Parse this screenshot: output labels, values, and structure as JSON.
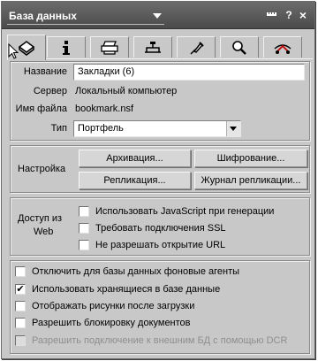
{
  "window": {
    "title": "База данных",
    "min_label": "▫▫▫",
    "help_label": "?",
    "close_label": "×"
  },
  "tabs": [
    {
      "icon": "database-icon",
      "active": true
    },
    {
      "icon": "info-icon"
    },
    {
      "icon": "printer-icon"
    },
    {
      "icon": "design-icon"
    },
    {
      "icon": "launch-icon"
    },
    {
      "icon": "magnifier-icon"
    },
    {
      "icon": "advanced-icon"
    }
  ],
  "basics": {
    "title_label": "Название",
    "title_value": "Закладки (6)",
    "server_label": "Сервер",
    "server_value": "Локальный компьютер",
    "filename_label": "Имя файла",
    "filename_value": "bookmark.nsf",
    "type_label": "Тип",
    "type_value": "Портфель"
  },
  "settings": {
    "label": "Настройка",
    "archive_button": "Архивация...",
    "encryption_button": "Шифрование...",
    "replication_button": "Репликация...",
    "replication_log_button": "Журнал репликации..."
  },
  "web": {
    "label_line1": "Доступ из",
    "label_line2": "Web",
    "options": [
      {
        "label": "Использовать JavaScript при генерации",
        "checked": false
      },
      {
        "label": "Требовать подключения SSL",
        "checked": false
      },
      {
        "label": "Не разрешать открытие URL",
        "checked": false
      }
    ]
  },
  "misc": {
    "options": [
      {
        "label": "Отключить для базы данных фоновые агенты",
        "checked": false,
        "mark": ""
      },
      {
        "label": "Использовать хранящиеся в базе данные",
        "checked": true,
        "mark": "✔"
      },
      {
        "label": "Отображать рисунки после загрузки",
        "checked": false,
        "mark": ""
      },
      {
        "label": "Разрешить блокировку документов",
        "checked": false,
        "mark": ""
      },
      {
        "label": "Разрешить подключение к внешним БД с помощью DCR",
        "checked": false,
        "disabled": true,
        "mark": ""
      }
    ]
  }
}
